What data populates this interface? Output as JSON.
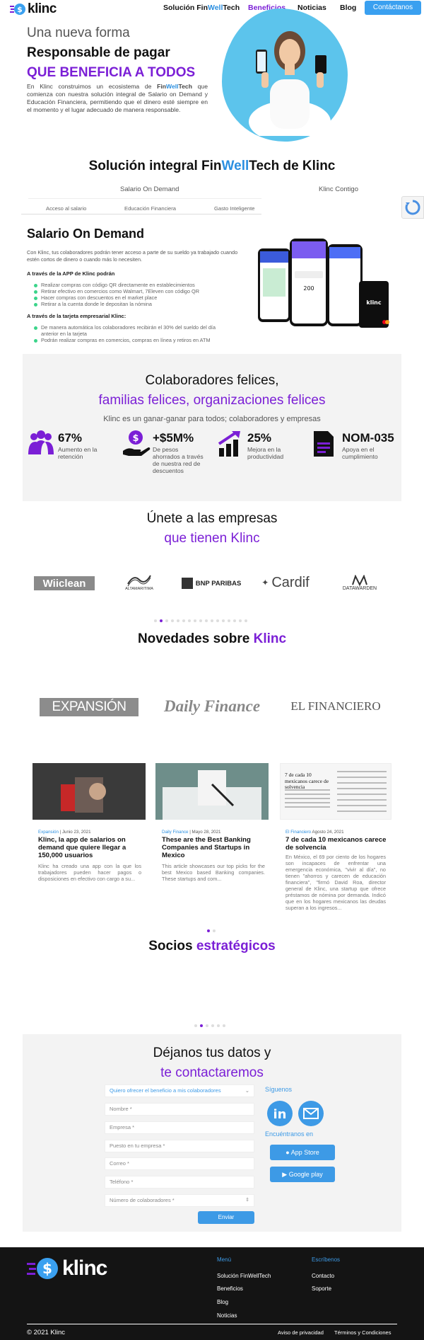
{
  "header": {
    "brand": "klinc",
    "nav": {
      "solucion_pre": "Solución Fin",
      "solucion_mid": "Well",
      "solucion_post": "Tech",
      "beneficios": "Beneficios",
      "noticias": "Noticias",
      "blog": "Blog",
      "contactanos": "Contáctanos"
    }
  },
  "hero": {
    "line1": "Una nueva forma",
    "line2": "Responsable de pagar",
    "line3": "QUE BENEFICIA A TODOS",
    "p_pre": "En Klinc construimos un ecosistema de ",
    "p_fin": "Fin",
    "p_well": "Well",
    "p_tech": "Tech",
    "p_post": " que comienza con nuestra solución integral de Salario on Demand y Educación Financiera, permitiendo que el dinero esté siempre en el momento y el lugar adecuado de manera responsable."
  },
  "solution": {
    "title_pre": "Solución integral Fin",
    "title_mid": "Well",
    "title_post": "Tech de Klinc",
    "tab1": "Salario On Demand",
    "tab2": "Klinc Contigo",
    "sub1": "Acceso al salario",
    "sub2": "Educación Financiera",
    "sub3": "Gasto Inteligente"
  },
  "salario": {
    "title": "Salario On Demand",
    "intro": "Con Klinc, tus colaboradores podrán tener acceso a parte de su sueldo ya trabajado cuando estén cortos de dinero o cuando más lo necesiten.",
    "app_heading": "A través de la APP de Klinc podrán",
    "app_items": [
      "Realizar compras con código QR directamente en establecimientos",
      "Retirar efectivo en comercios como Walmart, 7Eleven con código QR",
      "Hacer compras con descuentos en el market place",
      "Retirar a la cuenta donde le depositan la nómina"
    ],
    "card_heading": "A través de la tarjeta empresarial Klinc:",
    "card_items": [
      "De manera automática los colaboradores recibirán el 30% del sueldo del día anterior en la tarjeta",
      "Podrán realizar compras en comercios, compras en línea y retiros en ATM"
    ],
    "phone_amount": "200",
    "card_brand": "klinc"
  },
  "happy": {
    "line1": "Colaboradores felices,",
    "line2": "familias felices, organizaciones felices",
    "line3": "Klinc es un ganar-ganar para todos; colaboradores y empresas",
    "stats": [
      {
        "value": "67%",
        "label": "Aumento en la retención"
      },
      {
        "value": "+$5M%",
        "label": "De pesos ahorrados a través de nuestra red de descuentos"
      },
      {
        "value": "25%",
        "label": "Mejora en la productividad"
      },
      {
        "value": "NOM-035",
        "label": "Apoya en el cumplimiento"
      }
    ]
  },
  "companies": {
    "line1": "Únete a las empresas",
    "line2": "que tienen Klinc",
    "logos": [
      "Wiiclean",
      "ALTAMARITIMA",
      "BNP PARIBAS",
      "Cardif",
      "DATAWARDEN"
    ]
  },
  "news": {
    "title_pre": "Novedades sobre ",
    "title_brand": "Klinc",
    "media": [
      "EXPANSIÓN",
      "Daily Finance",
      "EL FINANCIERO"
    ],
    "posts": [
      {
        "source": "Expansión",
        "date": " | Junio 23, 2021",
        "title": "Klinc, la app de salarios on demand que quiere llegar a 150,000 usuarios",
        "text": "Klinc ha creado una app con la que los trabajadores pueden hacer pagos o disposiciones en efectivo con cargo a su..."
      },
      {
        "source": "Daily Finance",
        "date": " | Mayo 28, 2021",
        "title": "These are the Best Banking Companies and Startups in Mexico",
        "text": "This article showcases our top picks for the best Mexico based Banking companies. These startups and com..."
      },
      {
        "source": "El Financiero",
        "date": " Agosto 24, 2021",
        "title": "7 de cada 10 mexicanos carece de solvencia",
        "text": "En México, el 69 por ciento de los hogares son incapaces de enfrentar una emergencia económica, \"vivir al día\", no tienen \"ahorros y carecen de educación financiera\", \"firmó David Roa, director general de Klinc, una startup que ofrece préstamos de nómina por demanda. Indicó que en los hogares mexicanos las deudas superan a los ingresos..."
      }
    ],
    "thumb3_headline": "7 de cada 10 mexicanos carece de solvencia"
  },
  "partners": {
    "title_pre": "Socios ",
    "title_post": "estratégicos"
  },
  "contact": {
    "line1": "Déjanos tus datos y",
    "line2": "te contactaremos",
    "select_value": "Quiero ofrecer el beneficio a mis colaboradores",
    "fields": [
      "Nombre *",
      "Empresa *",
      "Puesto en tu empresa *",
      "Correo *",
      "Teléfono *",
      "Número de colaboradores *"
    ],
    "submit": "Enviar",
    "follow": "Síguenos",
    "find": "Encuéntranos en",
    "app_store": "App Store",
    "google_play": "Google play"
  },
  "footer": {
    "brand": "klinc",
    "menu_head": "Menú",
    "menu": [
      "Solución FinWellTech",
      "Beneficios",
      "Blog",
      "Noticias"
    ],
    "write_head": "Escríbenos",
    "write": [
      "Contacto",
      "Soporte"
    ],
    "copyright": "© 2021 Klinc",
    "privacy": "Aviso de privacidad",
    "terms": "Términos y Condiciones"
  },
  "colors": {
    "purple": "#7b1fd6",
    "blue": "#2b8fe0",
    "cta": "#3aa0f0",
    "footer": "#141414"
  }
}
